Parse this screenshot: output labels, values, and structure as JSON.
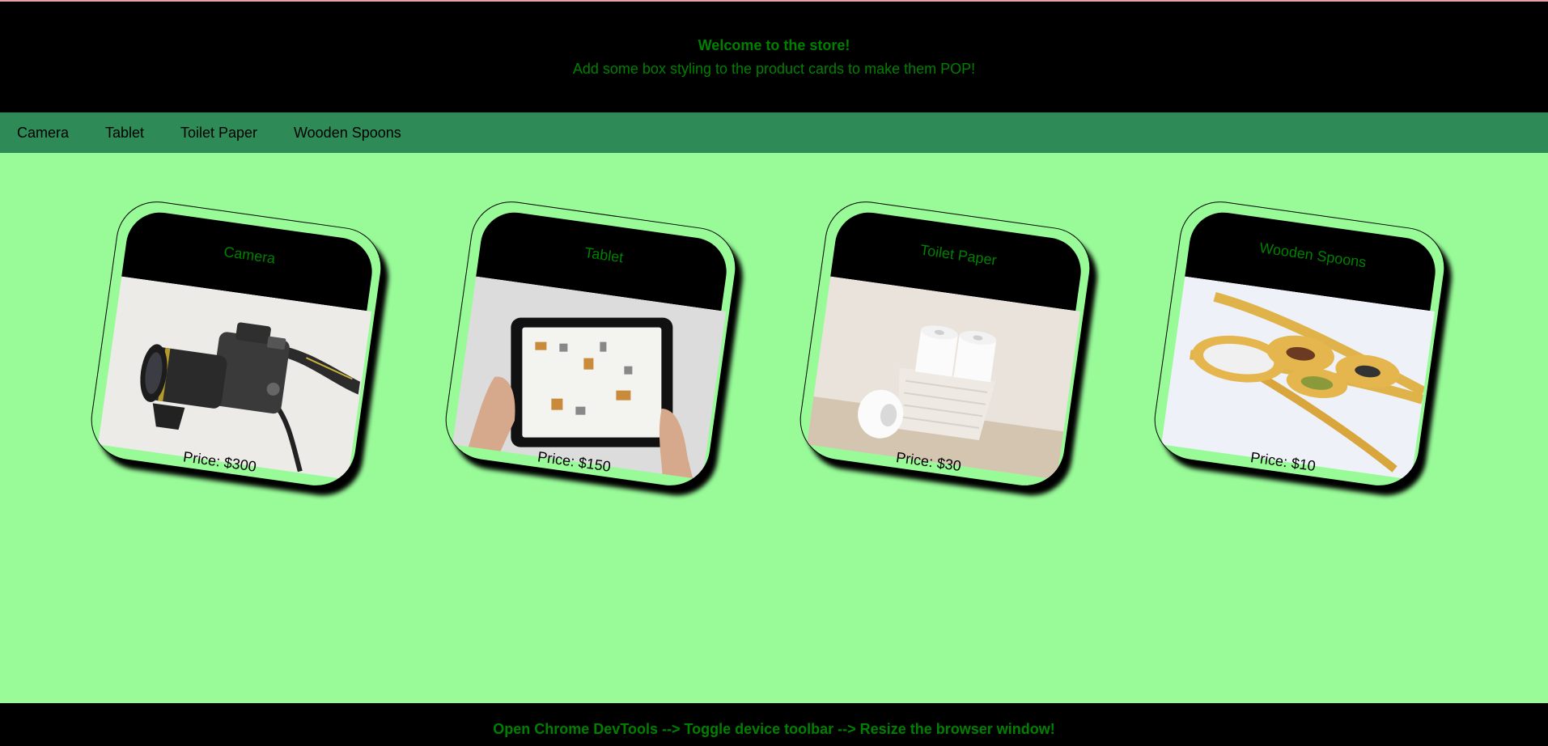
{
  "header": {
    "title": "Welcome to the store!",
    "subtitle": "Add some box styling to the product cards to make them POP!"
  },
  "nav": {
    "items": [
      {
        "label": "Camera"
      },
      {
        "label": "Tablet"
      },
      {
        "label": "Toilet Paper"
      },
      {
        "label": "Wooden Spoons"
      }
    ]
  },
  "products": [
    {
      "name": "Camera",
      "price": "Price: $300"
    },
    {
      "name": "Tablet",
      "price": "Price: $150"
    },
    {
      "name": "Toilet Paper",
      "price": "Price: $30"
    },
    {
      "name": "Wooden Spoons",
      "price": "Price: $10"
    }
  ],
  "footer": {
    "text": "Open Chrome DevTools --> Toggle device toolbar --> Resize the browser window!"
  },
  "colors": {
    "background": "#98fb98",
    "header": "#000000",
    "nav": "#2e8b57",
    "accent_text": "#008000"
  }
}
